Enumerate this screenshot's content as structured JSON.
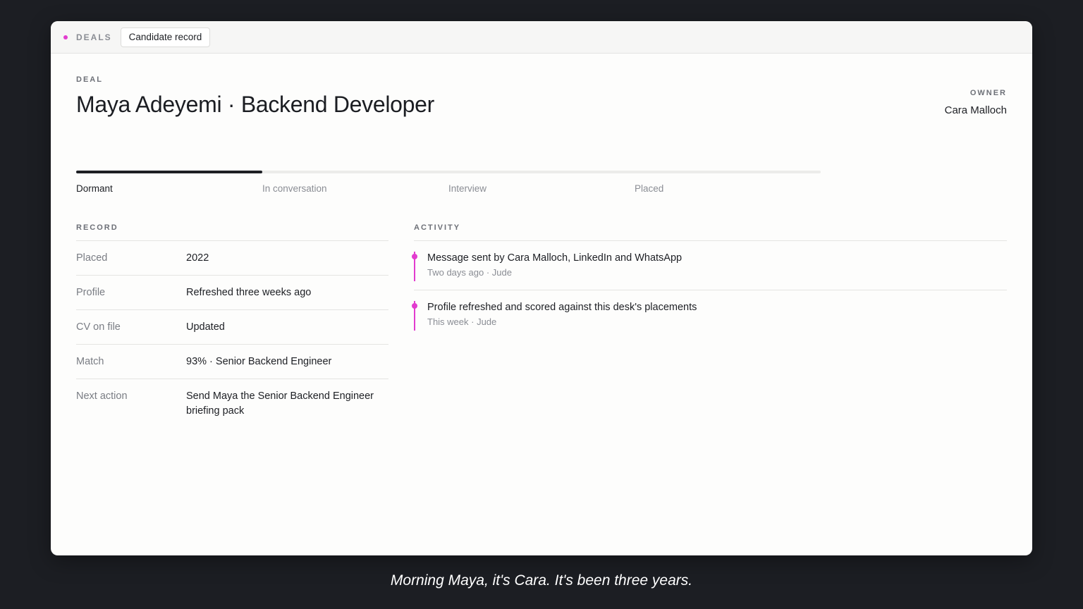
{
  "topbar": {
    "brand_label": "DEALS",
    "tab_label": "Candidate record",
    "accent_color": "#e23ccf"
  },
  "deal": {
    "eyebrow": "DEAL",
    "title": "Maya Adeyemi · Backend Developer"
  },
  "owner": {
    "label": "OWNER",
    "name": "Cara Malloch"
  },
  "stages": {
    "items": [
      "Dormant",
      "In conversation",
      "Interview",
      "Placed"
    ],
    "current_index": 0,
    "progress_fraction": 0.25
  },
  "record": {
    "heading": "RECORD",
    "rows": [
      {
        "key": "Placed",
        "value": "2022"
      },
      {
        "key": "Profile",
        "value": "Refreshed three weeks ago"
      },
      {
        "key": "CV on file",
        "value": "Updated"
      },
      {
        "key": "Match",
        "value": "93% · Senior Backend Engineer"
      },
      {
        "key": "Next action",
        "value": "Send Maya the Senior Backend Engineer briefing pack"
      }
    ]
  },
  "activity": {
    "heading": "ACTIVITY",
    "items": [
      {
        "title": "Message sent by Cara Malloch, LinkedIn and WhatsApp",
        "meta": "Two days ago · Jude"
      },
      {
        "title": "Profile refreshed and scored against this desk's placements",
        "meta": "This week · Jude"
      }
    ]
  },
  "caption": "Morning Maya, it's Cara. It's been three years."
}
